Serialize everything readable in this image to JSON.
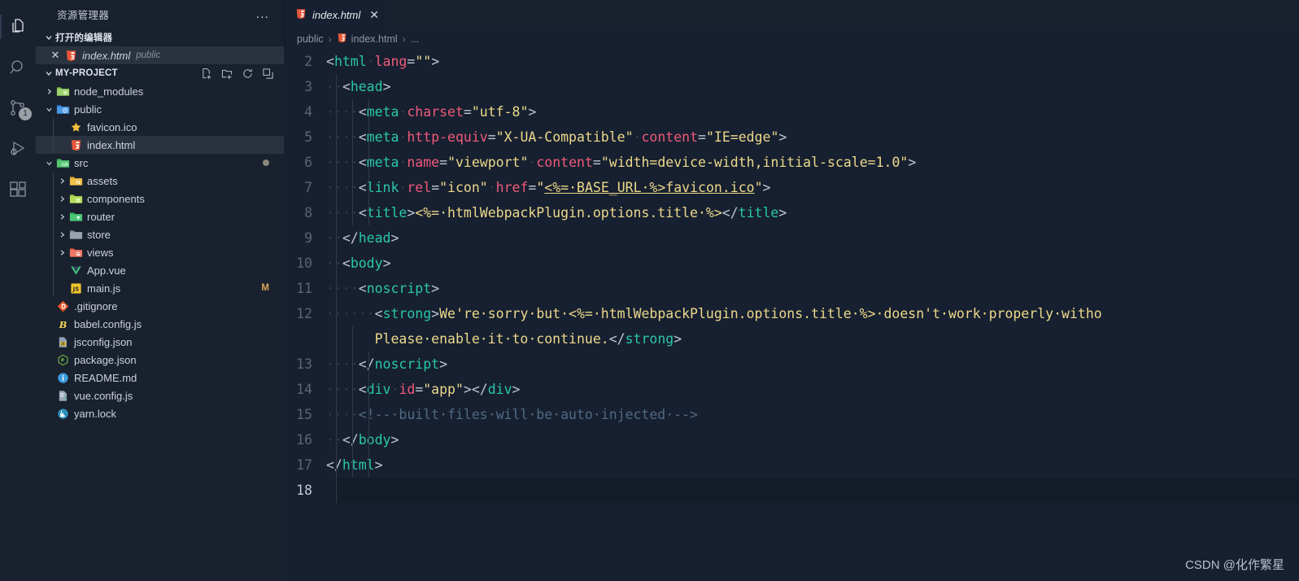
{
  "activity_bar": {
    "items": [
      {
        "name": "explorer",
        "icon": "files-icon",
        "active": true,
        "badge": ""
      },
      {
        "name": "search",
        "icon": "search-icon",
        "active": false,
        "badge": ""
      },
      {
        "name": "source-control",
        "icon": "source-control-icon",
        "active": false,
        "badge": "1"
      },
      {
        "name": "run-and-debug",
        "icon": "run-debug-icon",
        "active": false,
        "badge": ""
      },
      {
        "name": "extensions",
        "icon": "extensions-icon",
        "active": false,
        "badge": ""
      }
    ]
  },
  "sidebar": {
    "title": "资源管理器",
    "more_actions": "...",
    "open_editors": {
      "label": "打开的编辑器",
      "items": [
        {
          "name": "index.html",
          "folder": "public",
          "selected": true,
          "close": "✕",
          "icon": "html-file-icon"
        }
      ]
    },
    "project": {
      "label": "MY-PROJECT",
      "actions": [
        {
          "name": "new-file",
          "icon": "new-file-icon"
        },
        {
          "name": "new-folder",
          "icon": "new-folder-icon"
        },
        {
          "name": "refresh",
          "icon": "refresh-icon"
        },
        {
          "name": "collapse-all",
          "icon": "collapse-all-icon"
        }
      ],
      "tree": [
        {
          "name": "node_modules",
          "type": "folder",
          "icon": "folder-node-icon",
          "expanded": false,
          "depth": 1,
          "selected": false,
          "badge": ""
        },
        {
          "name": "public",
          "type": "folder",
          "icon": "folder-public-icon",
          "expanded": true,
          "depth": 1,
          "selected": false,
          "badge": ""
        },
        {
          "name": "favicon.ico",
          "type": "file",
          "icon": "favicon-star-icon",
          "depth": 2,
          "selected": false,
          "badge": ""
        },
        {
          "name": "index.html",
          "type": "file",
          "icon": "html-file-icon",
          "depth": 2,
          "selected": true,
          "badge": ""
        },
        {
          "name": "src",
          "type": "folder",
          "icon": "folder-src-icon",
          "expanded": true,
          "depth": 1,
          "selected": false,
          "badge": "",
          "dot": true
        },
        {
          "name": "assets",
          "type": "folder",
          "icon": "folder-assets-icon",
          "expanded": false,
          "depth": 2,
          "selected": false,
          "badge": ""
        },
        {
          "name": "components",
          "type": "folder",
          "icon": "folder-components-icon",
          "expanded": false,
          "depth": 2,
          "selected": false,
          "badge": ""
        },
        {
          "name": "router",
          "type": "folder",
          "icon": "folder-router-icon",
          "expanded": false,
          "depth": 2,
          "selected": false,
          "badge": ""
        },
        {
          "name": "store",
          "type": "folder",
          "icon": "folder-plain-icon",
          "expanded": false,
          "depth": 2,
          "selected": false,
          "badge": ""
        },
        {
          "name": "views",
          "type": "folder",
          "icon": "folder-views-icon",
          "expanded": false,
          "depth": 2,
          "selected": false,
          "badge": ""
        },
        {
          "name": "App.vue",
          "type": "file",
          "icon": "vue-file-icon",
          "depth": 2,
          "selected": false,
          "badge": ""
        },
        {
          "name": "main.js",
          "type": "file",
          "icon": "js-file-icon",
          "depth": 2,
          "selected": false,
          "badge": "M"
        },
        {
          "name": ".gitignore",
          "type": "file",
          "icon": "git-file-icon",
          "depth": 1,
          "selected": false,
          "badge": ""
        },
        {
          "name": "babel.config.js",
          "type": "file",
          "icon": "babel-file-icon",
          "depth": 1,
          "selected": false,
          "badge": ""
        },
        {
          "name": "jsconfig.json",
          "type": "file",
          "icon": "jsconfig-file-icon",
          "depth": 1,
          "selected": false,
          "badge": ""
        },
        {
          "name": "package.json",
          "type": "file",
          "icon": "npm-file-icon",
          "depth": 1,
          "selected": false,
          "badge": ""
        },
        {
          "name": "README.md",
          "type": "file",
          "icon": "readme-info-icon",
          "depth": 1,
          "selected": false,
          "badge": ""
        },
        {
          "name": "vue.config.js",
          "type": "file",
          "icon": "vue-config-icon",
          "depth": 1,
          "selected": false,
          "badge": ""
        },
        {
          "name": "yarn.lock",
          "type": "file",
          "icon": "yarn-file-icon",
          "depth": 1,
          "selected": false,
          "badge": ""
        }
      ]
    }
  },
  "editor": {
    "tabs": [
      {
        "label": "index.html",
        "icon": "html-file-icon",
        "active": true,
        "close": "✕"
      }
    ],
    "breadcrumb": [
      {
        "label": "public",
        "icon": ""
      },
      {
        "label": "index.html",
        "icon": "html-file-icon"
      },
      {
        "label": "...",
        "icon": ""
      }
    ],
    "breadcrumb_separator": "›",
    "first_visible_line": 2,
    "active_line": 18,
    "lines": [
      {
        "num": "2",
        "segments": [
          {
            "t": "<",
            "c": "pun"
          },
          {
            "t": "html",
            "c": "tag"
          },
          {
            "t": "·",
            "c": "wsdot"
          },
          {
            "t": "lang",
            "c": "attr"
          },
          {
            "t": "=",
            "c": "pun"
          },
          {
            "t": "\"\"",
            "c": "str"
          },
          {
            "t": ">",
            "c": "pun"
          }
        ]
      },
      {
        "num": "3",
        "segments": [
          {
            "t": "··",
            "c": "wsdot"
          },
          {
            "t": "<",
            "c": "pun"
          },
          {
            "t": "head",
            "c": "tag"
          },
          {
            "t": ">",
            "c": "pun"
          }
        ]
      },
      {
        "num": "4",
        "segments": [
          {
            "t": "··",
            "c": "wsdot"
          },
          {
            "t": "··",
            "c": "wsdot"
          },
          {
            "t": "<",
            "c": "pun"
          },
          {
            "t": "meta",
            "c": "tag"
          },
          {
            "t": "·",
            "c": "wsdot"
          },
          {
            "t": "charset",
            "c": "attr"
          },
          {
            "t": "=",
            "c": "pun"
          },
          {
            "t": "\"utf-8\"",
            "c": "str"
          },
          {
            "t": ">",
            "c": "pun"
          }
        ]
      },
      {
        "num": "5",
        "segments": [
          {
            "t": "··",
            "c": "wsdot"
          },
          {
            "t": "··",
            "c": "wsdot"
          },
          {
            "t": "<",
            "c": "pun"
          },
          {
            "t": "meta",
            "c": "tag"
          },
          {
            "t": "·",
            "c": "wsdot"
          },
          {
            "t": "http-equiv",
            "c": "attr"
          },
          {
            "t": "=",
            "c": "pun"
          },
          {
            "t": "\"X-UA-Compatible\"",
            "c": "str"
          },
          {
            "t": "·",
            "c": "wsdot"
          },
          {
            "t": "content",
            "c": "attr"
          },
          {
            "t": "=",
            "c": "pun"
          },
          {
            "t": "\"IE=edge\"",
            "c": "str"
          },
          {
            "t": ">",
            "c": "pun"
          }
        ]
      },
      {
        "num": "6",
        "segments": [
          {
            "t": "··",
            "c": "wsdot"
          },
          {
            "t": "··",
            "c": "wsdot"
          },
          {
            "t": "<",
            "c": "pun"
          },
          {
            "t": "meta",
            "c": "tag"
          },
          {
            "t": "·",
            "c": "wsdot"
          },
          {
            "t": "name",
            "c": "attr"
          },
          {
            "t": "=",
            "c": "pun"
          },
          {
            "t": "\"viewport\"",
            "c": "str"
          },
          {
            "t": "·",
            "c": "wsdot"
          },
          {
            "t": "content",
            "c": "attr"
          },
          {
            "t": "=",
            "c": "pun"
          },
          {
            "t": "\"width=device-width,initial-scale=1.0\"",
            "c": "str"
          },
          {
            "t": ">",
            "c": "pun"
          }
        ]
      },
      {
        "num": "7",
        "segments": [
          {
            "t": "··",
            "c": "wsdot"
          },
          {
            "t": "··",
            "c": "wsdot"
          },
          {
            "t": "<",
            "c": "pun"
          },
          {
            "t": "link",
            "c": "tag"
          },
          {
            "t": "·",
            "c": "wsdot"
          },
          {
            "t": "rel",
            "c": "attr"
          },
          {
            "t": "=",
            "c": "pun"
          },
          {
            "t": "\"icon\"",
            "c": "str"
          },
          {
            "t": "·",
            "c": "wsdot"
          },
          {
            "t": "href",
            "c": "attr"
          },
          {
            "t": "=",
            "c": "pun"
          },
          {
            "t": "\"",
            "c": "str"
          },
          {
            "t": "<%=·BASE_URL·%>favicon.ico",
            "c": "link-str"
          },
          {
            "t": "\"",
            "c": "str"
          },
          {
            "t": ">",
            "c": "pun"
          }
        ]
      },
      {
        "num": "8",
        "segments": [
          {
            "t": "··",
            "c": "wsdot"
          },
          {
            "t": "··",
            "c": "wsdot"
          },
          {
            "t": "<",
            "c": "pun"
          },
          {
            "t": "title",
            "c": "tag"
          },
          {
            "t": ">",
            "c": "pun"
          },
          {
            "t": "<%=·htmlWebpackPlugin.options.title·%>",
            "c": "str"
          },
          {
            "t": "</",
            "c": "pun"
          },
          {
            "t": "title",
            "c": "tag"
          },
          {
            "t": ">",
            "c": "pun"
          }
        ]
      },
      {
        "num": "9",
        "segments": [
          {
            "t": "··",
            "c": "wsdot"
          },
          {
            "t": "</",
            "c": "pun"
          },
          {
            "t": "head",
            "c": "tag"
          },
          {
            "t": ">",
            "c": "pun"
          }
        ]
      },
      {
        "num": "10",
        "segments": [
          {
            "t": "··",
            "c": "wsdot"
          },
          {
            "t": "<",
            "c": "pun"
          },
          {
            "t": "body",
            "c": "tag"
          },
          {
            "t": ">",
            "c": "pun"
          }
        ]
      },
      {
        "num": "11",
        "segments": [
          {
            "t": "··",
            "c": "wsdot"
          },
          {
            "t": "··",
            "c": "wsdot"
          },
          {
            "t": "<",
            "c": "pun"
          },
          {
            "t": "noscript",
            "c": "tag"
          },
          {
            "t": ">",
            "c": "pun"
          }
        ]
      },
      {
        "num": "12",
        "wrapped": true,
        "segments": [
          {
            "t": "··",
            "c": "wsdot"
          },
          {
            "t": "··",
            "c": "wsdot"
          },
          {
            "t": "··",
            "c": "wsdot"
          },
          {
            "t": "<",
            "c": "pun"
          },
          {
            "t": "strong",
            "c": "tag"
          },
          {
            "t": ">",
            "c": "pun"
          },
          {
            "t": "We're·sorry·but·<%=·htmlWebpackPlugin.options.title·%>·doesn't·work·properly·witho",
            "c": "str"
          }
        ],
        "segments2": [
          {
            "t": "      ",
            "c": "wsdot"
          },
          {
            "t": "Please·enable·it·to·continue.",
            "c": "str"
          },
          {
            "t": "</",
            "c": "pun"
          },
          {
            "t": "strong",
            "c": "tag"
          },
          {
            "t": ">",
            "c": "pun"
          }
        ]
      },
      {
        "num": "13",
        "segments": [
          {
            "t": "··",
            "c": "wsdot"
          },
          {
            "t": "··",
            "c": "wsdot"
          },
          {
            "t": "</",
            "c": "pun"
          },
          {
            "t": "noscript",
            "c": "tag"
          },
          {
            "t": ">",
            "c": "pun"
          }
        ]
      },
      {
        "num": "14",
        "segments": [
          {
            "t": "··",
            "c": "wsdot"
          },
          {
            "t": "··",
            "c": "wsdot"
          },
          {
            "t": "<",
            "c": "pun"
          },
          {
            "t": "div",
            "c": "tag"
          },
          {
            "t": "·",
            "c": "wsdot"
          },
          {
            "t": "id",
            "c": "attr"
          },
          {
            "t": "=",
            "c": "pun"
          },
          {
            "t": "\"app\"",
            "c": "str"
          },
          {
            "t": ">",
            "c": "pun"
          },
          {
            "t": "</",
            "c": "pun"
          },
          {
            "t": "div",
            "c": "tag"
          },
          {
            "t": ">",
            "c": "pun"
          }
        ]
      },
      {
        "num": "15",
        "segments": [
          {
            "t": "··",
            "c": "wsdot"
          },
          {
            "t": "··",
            "c": "wsdot"
          },
          {
            "t": "<!--·built·files·will·be·auto·injected·-->",
            "c": "com"
          }
        ]
      },
      {
        "num": "16",
        "segments": [
          {
            "t": "··",
            "c": "wsdot"
          },
          {
            "t": "</",
            "c": "pun"
          },
          {
            "t": "body",
            "c": "tag"
          },
          {
            "t": ">",
            "c": "pun"
          }
        ]
      },
      {
        "num": "17",
        "segments": [
          {
            "t": "</",
            "c": "pun"
          },
          {
            "t": "html",
            "c": "tag"
          },
          {
            "t": ">",
            "c": "pun"
          }
        ]
      },
      {
        "num": "18",
        "active": true,
        "segments": []
      }
    ]
  },
  "watermark": "CSDN @化作繁星",
  "colors": {
    "activity_bar_bg": "#19212e",
    "sidebar_bg": "#19212e",
    "editor_bg": "#172030",
    "tab_active_bg": "#172030",
    "row_selected_bg": "#2a3240",
    "tag": "#29c7aa",
    "attribute": "#ef5a7a",
    "string": "#ecd98b",
    "comment": "#4f6a84",
    "punctuation": "#bfc7d5",
    "line_number": "#5a6575"
  }
}
